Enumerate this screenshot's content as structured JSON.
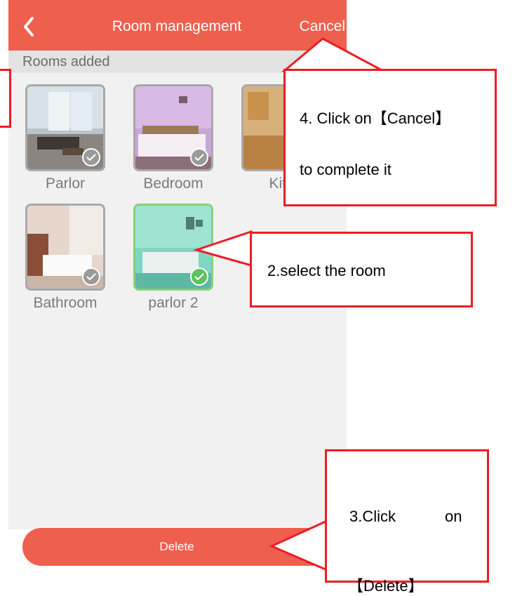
{
  "header": {
    "title": "Room management",
    "cancel_label": "Cancel"
  },
  "section": {
    "label": "Rooms added"
  },
  "rooms": [
    {
      "label": "Parlor",
      "selected": false
    },
    {
      "label": "Bedroom",
      "selected": false
    },
    {
      "label": "Kitc",
      "selected": false
    },
    {
      "label": "Bathroom",
      "selected": false
    },
    {
      "label": "parlor 2",
      "selected": true
    }
  ],
  "footer": {
    "delete_label": "Delete"
  },
  "callouts": {
    "step4": {
      "line1": "4. Click on【Cancel】",
      "line2": "to complete it"
    },
    "step2": {
      "text": "2.select the room"
    },
    "step3": {
      "word1": "3.Click",
      "word2": "on",
      "word3": "【Delete】"
    }
  },
  "colors": {
    "accent": "#ef5f4e",
    "callout_border": "#ee1c25",
    "selected_border": "#8ad178",
    "check_selected": "#5ec25d"
  }
}
